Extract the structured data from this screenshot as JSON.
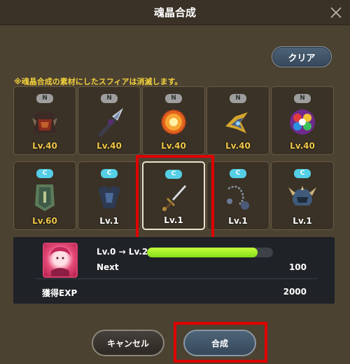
{
  "dialog": {
    "title": "魂晶合成"
  },
  "toolbar": {
    "clear_label": "クリア"
  },
  "notice": "※魂晶合成の素材にしたスフィアは消滅します。",
  "slots": [
    {
      "rarity": "N",
      "level": "Lv.40",
      "icon": "demon-armor-icon"
    },
    {
      "rarity": "N",
      "level": "Lv.40",
      "icon": "drill-spear-icon"
    },
    {
      "rarity": "N",
      "level": "Lv.40",
      "icon": "flame-orb-icon"
    },
    {
      "rarity": "N",
      "level": "Lv.40",
      "icon": "gold-bow-icon"
    },
    {
      "rarity": "N",
      "level": "Lv.40",
      "icon": "rainbow-flower-icon"
    },
    {
      "rarity": "C",
      "level": "Lv.60",
      "icon": "shield-icon"
    },
    {
      "rarity": "C",
      "level": "Lv.1",
      "icon": "dark-armor-icon"
    },
    {
      "rarity": "C",
      "level": "Lv.1",
      "icon": "sword-icon"
    },
    {
      "rarity": "C",
      "level": "Lv.1",
      "icon": "chain-flail-icon"
    },
    {
      "rarity": "C",
      "level": "Lv.1",
      "icon": "horned-helmet-icon"
    }
  ],
  "status": {
    "level_change": "Lv.0 → Lv.2",
    "exp_progress": 0.88,
    "next_label": "Next",
    "next_value": "100",
    "gained_label": "獲得EXP",
    "gained_value": "2000"
  },
  "actions": {
    "cancel_label": "キャンセル",
    "synth_label": "合成"
  },
  "colors": {
    "highlight": "#e00000",
    "exp_bar": "#a8f02a",
    "badge_c": "#55cfe6",
    "badge_n": "#9e9e9e",
    "notice": "#f3d23b"
  }
}
